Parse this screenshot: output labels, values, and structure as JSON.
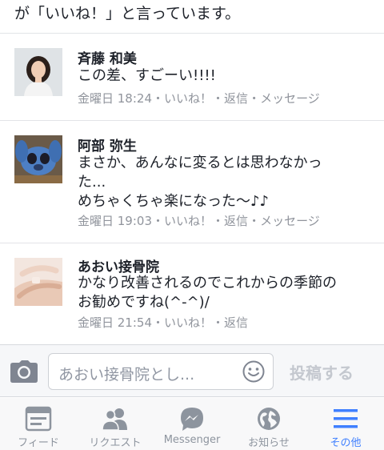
{
  "header": {
    "likes_text": "が「いいね！」と言っています。"
  },
  "comments": [
    {
      "author": "斉藤 和美",
      "lines": [
        "この差、すごーい!!!!"
      ],
      "time": "金曜日 18:24",
      "actions": [
        "いいね！",
        "返信",
        "メッセージ"
      ]
    },
    {
      "author": "阿部 弥生",
      "lines": [
        "まさか、あんなに変るとは思わなかっ",
        "た...",
        "めちゃくちゃ楽になった〜♪♪"
      ],
      "time": "金曜日 19:03",
      "actions": [
        "いいね！",
        "返信",
        "メッセージ"
      ]
    },
    {
      "author": "あおい接骨院",
      "lines": [
        "かなり改善されるのでこれからの季節の",
        "お勧めですね(^-^)/"
      ],
      "time": "金曜日 21:54",
      "actions": [
        "いいね！",
        "返信"
      ]
    }
  ],
  "meta_separator": "・",
  "composer": {
    "placeholder": "あおい接骨院とし...",
    "post_label": "投稿する",
    "camera_icon": "camera-icon",
    "emoji_icon": "smiley-icon"
  },
  "tabbar": {
    "items": [
      {
        "label": "フィード",
        "icon": "feed-icon",
        "active": false
      },
      {
        "label": "リクエスト",
        "icon": "friend-requests-icon",
        "active": false
      },
      {
        "label": "Messenger",
        "icon": "messenger-icon",
        "active": false
      },
      {
        "label": "お知らせ",
        "icon": "globe-icon",
        "active": false
      },
      {
        "label": "その他",
        "icon": "menu-icon",
        "active": true
      }
    ]
  },
  "colors": {
    "text": "#1d2129",
    "meta": "#90949c",
    "tab_inactive": "#8d949e",
    "tab_active": "#4080ff",
    "post_disabled": "#c4c8cf"
  }
}
